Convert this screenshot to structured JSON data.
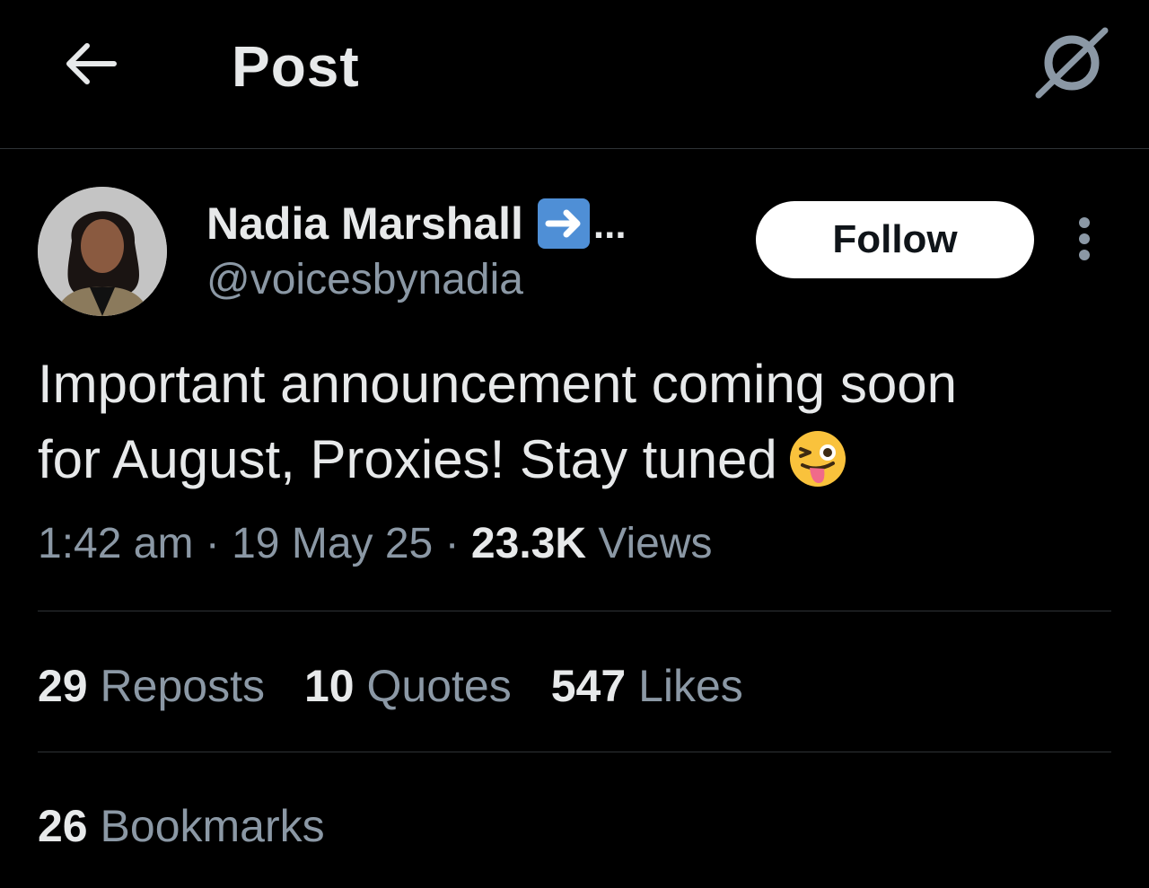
{
  "header": {
    "title": "Post",
    "back_icon": "arrow-left-icon",
    "grok_icon": "grok-icon"
  },
  "author": {
    "display_name": "Nadia Marshall",
    "name_emoji": "right-arrow-emoji",
    "ellipsis": "...",
    "handle": "@voicesbynadia"
  },
  "follow_label": "Follow",
  "tweet": {
    "line1": "Important announcement coming soon",
    "line2": "for August, Proxies! Stay tuned",
    "emoji": "winking-face-with-tongue-emoji"
  },
  "meta": {
    "time": "1:42 am",
    "sep1": "·",
    "date": "19 May 25",
    "sep2": "·",
    "views_count": "23.3K",
    "views_label": "Views"
  },
  "stats": {
    "reposts_count": "29",
    "reposts_label": "Reposts",
    "quotes_count": "10",
    "quotes_label": "Quotes",
    "likes_count": "547",
    "likes_label": "Likes",
    "bookmarks_count": "26",
    "bookmarks_label": "Bookmarks"
  },
  "colors": {
    "background": "#000000",
    "primary_text": "#e7e9ea",
    "secondary_text": "#8b98a5",
    "divider": "#2f3336",
    "follow_bg": "#ffffff"
  }
}
